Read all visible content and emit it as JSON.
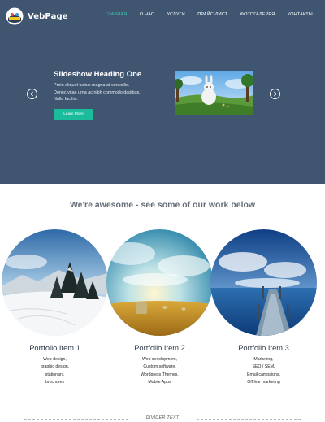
{
  "header": {
    "brand": "VebPage",
    "nav": [
      {
        "label": "ГЛАВНАЯ",
        "active": true
      },
      {
        "label": "О НАС",
        "active": false
      },
      {
        "label": "УСЛУГИ",
        "active": false
      },
      {
        "label": "ПРАЙС-ЛИСТ",
        "active": false
      },
      {
        "label": "ФОТОГАЛЕРЕЯ",
        "active": false
      },
      {
        "label": "КОНТАКТЫ",
        "active": false
      }
    ]
  },
  "slideshow": {
    "heading": "Slideshow Heading One",
    "text": "Proin aliquet luctus magna at convallis. Donec vitae urna ac nibh commodo dapibus. Nulla facilisi.",
    "button": "Learn More"
  },
  "section": {
    "heading": "We're awesome - see some of our work below"
  },
  "portfolio": [
    {
      "title": "Portfolio Item 1",
      "lines": [
        "Web design,",
        "graphic design,",
        "stationary,",
        "brochures"
      ]
    },
    {
      "title": "Portfolio Item 2",
      "lines": [
        "Web development,",
        "Custom software,",
        "Wordpress Themes,",
        "Mobile Apps"
      ]
    },
    {
      "title": "Portfolio Item 3",
      "lines": [
        "Marketing,",
        "SEO / SEM,",
        "Email campaigns,",
        "Off line marketing"
      ]
    }
  ],
  "divider": {
    "text": "DIVIDER TEXT"
  },
  "colors": {
    "hero_bg": "#3f5570",
    "accent": "#41c1ae",
    "button": "#1abc9c"
  }
}
